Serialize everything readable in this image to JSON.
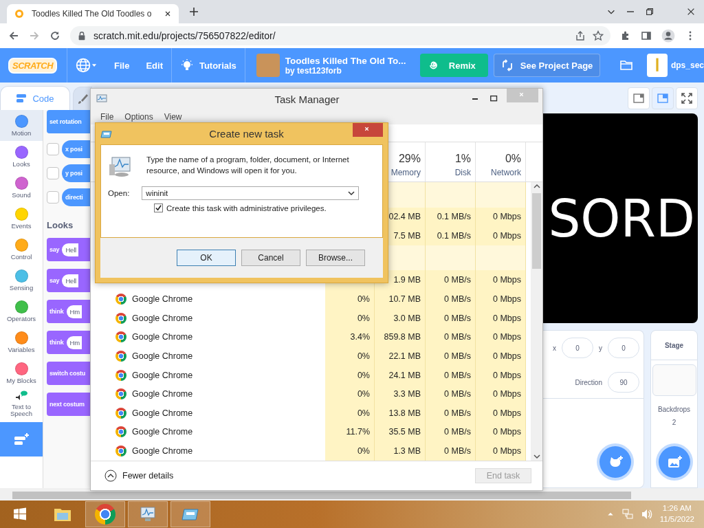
{
  "browser": {
    "tab": {
      "title": "Toodles Killed The Old Toodles o"
    },
    "address": "scratch.mit.edu/projects/756507822/editor/"
  },
  "scratch": {
    "logo": "SCRATCH",
    "menu": [
      {
        "label": "File"
      },
      {
        "label": "Edit"
      }
    ],
    "tutorials": "Tutorials",
    "project": {
      "title": "Toodles Killed The Old To...",
      "author": "by test123forb"
    },
    "remix": "Remix",
    "see_project": "See Project Page",
    "user": "dps_sec",
    "editor_tabs": [
      {
        "kind": "code",
        "label": "Code",
        "selected": true
      },
      {
        "kind": "costumes",
        "selected": false
      }
    ],
    "categories": [
      {
        "kind": "dot",
        "label": "Motion",
        "color": "#4c97ff",
        "selected": true
      },
      {
        "kind": "dot",
        "label": "Looks",
        "color": "#9966ff",
        "selected": false
      },
      {
        "kind": "dot",
        "label": "Sound",
        "color": "#cf63cf",
        "selected": false
      },
      {
        "kind": "dot",
        "label": "Events",
        "color": "#ffd500",
        "selected": false
      },
      {
        "kind": "dot",
        "label": "Control",
        "color": "#ffab19",
        "selected": false
      },
      {
        "kind": "dot",
        "label": "Sensing",
        "color": "#4cbfe6",
        "selected": false
      },
      {
        "kind": "dot",
        "label": "Operators",
        "color": "#40bf4a",
        "selected": false
      },
      {
        "kind": "dot",
        "label": "Variables",
        "color": "#ff8c1a",
        "selected": false
      },
      {
        "kind": "dot",
        "label": "My Blocks",
        "color": "#ff6680",
        "selected": false
      },
      {
        "kind": "extension",
        "label": "Text to Speech",
        "selected": false
      }
    ],
    "blocks": [
      {
        "kind": "stack",
        "text": "set rotation",
        "color": "#4c97ff"
      },
      {
        "kind": "reporter",
        "text": "x posi",
        "color": "#4c97ff",
        "checked": false
      },
      {
        "kind": "reporter",
        "text": "y posi",
        "color": "#4c97ff",
        "checked": false
      },
      {
        "kind": "reporter",
        "text": "directi",
        "color": "#4c97ff",
        "checked": false
      },
      {
        "kind": "heading",
        "text": "Looks"
      },
      {
        "kind": "stack",
        "text": "say",
        "input": "Hell",
        "color": "#9966ff"
      },
      {
        "kind": "stack",
        "text": "say",
        "input": "Hell",
        "color": "#9966ff"
      },
      {
        "kind": "stack",
        "text": "think",
        "input": "Hm",
        "color": "#9966ff"
      },
      {
        "kind": "stack",
        "text": "think",
        "input": "Hm",
        "color": "#9966ff"
      },
      {
        "kind": "stack",
        "text": "switch costu",
        "color": "#9966ff"
      },
      {
        "kind": "stack",
        "text": "next costum",
        "color": "#9966ff"
      }
    ],
    "stage": {
      "text": "SORD",
      "layout_buttons": [
        {
          "kind": "small",
          "selected": false
        },
        {
          "kind": "normal",
          "selected": true
        },
        {
          "kind": "fullscreen",
          "selected": false
        }
      ]
    },
    "sprite_info": {
      "fields": [
        {
          "label": "x",
          "value": "0"
        },
        {
          "label": "y",
          "value": "0"
        },
        {
          "label": "Direction",
          "value": "90"
        }
      ]
    },
    "stage_panel": {
      "title": "Stage",
      "label": "Backdrops",
      "count": "2"
    }
  },
  "task_manager": {
    "title": "Task Manager",
    "menu": [
      "File",
      "Options",
      "View"
    ],
    "columns": [
      {
        "percent": "29%",
        "label": "Memory"
      },
      {
        "percent": "1%",
        "label": "Disk"
      },
      {
        "percent": "0%",
        "label": "Network"
      }
    ],
    "rows": [
      {
        "kind": "group"
      },
      {
        "kind": "process",
        "memory": "02.4 MB",
        "disk": "0.1 MB/s",
        "network": "0 Mbps"
      },
      {
        "kind": "process",
        "memory": "7.5 MB",
        "disk": "0.1 MB/s",
        "network": "0 Mbps"
      },
      {
        "kind": "group"
      },
      {
        "kind": "process",
        "memory": "1.9 MB",
        "disk": "0 MB/s",
        "network": "0 Mbps"
      },
      {
        "kind": "process",
        "name": "Google Chrome",
        "cpu": "0%",
        "memory": "10.7 MB",
        "disk": "0 MB/s",
        "network": "0 Mbps"
      },
      {
        "kind": "process",
        "name": "Google Chrome",
        "cpu": "0%",
        "memory": "3.0 MB",
        "disk": "0 MB/s",
        "network": "0 Mbps"
      },
      {
        "kind": "process",
        "name": "Google Chrome",
        "cpu": "3.4%",
        "memory": "859.8 MB",
        "disk": "0 MB/s",
        "network": "0 Mbps"
      },
      {
        "kind": "process",
        "name": "Google Chrome",
        "cpu": "0%",
        "memory": "22.1 MB",
        "disk": "0 MB/s",
        "network": "0 Mbps"
      },
      {
        "kind": "process",
        "name": "Google Chrome",
        "cpu": "0%",
        "memory": "24.1 MB",
        "disk": "0 MB/s",
        "network": "0 Mbps"
      },
      {
        "kind": "process",
        "name": "Google Chrome",
        "cpu": "0%",
        "memory": "3.3 MB",
        "disk": "0 MB/s",
        "network": "0 Mbps"
      },
      {
        "kind": "process",
        "name": "Google Chrome",
        "cpu": "0%",
        "memory": "13.8 MB",
        "disk": "0 MB/s",
        "network": "0 Mbps"
      },
      {
        "kind": "process",
        "name": "Google Chrome",
        "cpu": "11.7%",
        "memory": "35.5 MB",
        "disk": "0 MB/s",
        "network": "0 Mbps"
      },
      {
        "kind": "process",
        "name": "Google Chrome",
        "cpu": "0%",
        "memory": "1.3 MB",
        "disk": "0 MB/s",
        "network": "0 Mbps"
      }
    ],
    "fewer_details": "Fewer details",
    "end_task": {
      "label": "End task",
      "disabled": true
    }
  },
  "dialog": {
    "title": "Create new task",
    "message": "Type the name of a program, folder, document, or Internet resource, and Windows will open it for you.",
    "open_label": "Open:",
    "value": "wininit",
    "admin": {
      "label": "Create this task with administrative privileges.",
      "checked": true
    },
    "buttons": [
      {
        "label": "OK",
        "default": true
      },
      {
        "label": "Cancel",
        "default": false
      },
      {
        "label": "Browse...",
        "default": false
      }
    ]
  },
  "taskbar": {
    "apps": [
      {
        "kind": "explorer",
        "active": false
      },
      {
        "kind": "chrome",
        "active": true
      },
      {
        "kind": "monitor",
        "active": true
      },
      {
        "kind": "run",
        "active": true
      }
    ],
    "time": "1:26 AM",
    "date": "11/5/2022"
  }
}
